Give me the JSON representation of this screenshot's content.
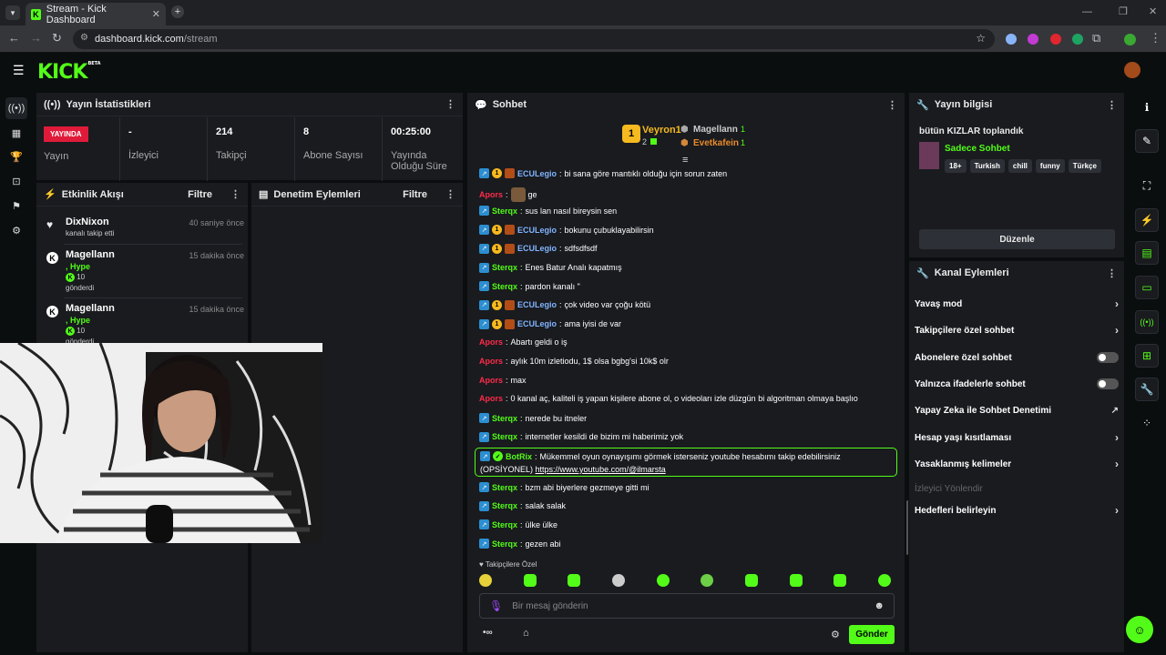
{
  "browser": {
    "tab_title": "Stream - Kick Dashboard",
    "url_host": "dashboard.kick.com",
    "url_path": "/stream"
  },
  "logo": {
    "text": "KICK",
    "beta": "BETA"
  },
  "stats_panel": {
    "title": "Yayın İstatistikleri",
    "live_badge": "YAYINDA",
    "stats": [
      {
        "value": "",
        "label": "Yayın"
      },
      {
        "value": "-",
        "label": "İzleyici"
      },
      {
        "value": "214",
        "label": "Takipçi"
      },
      {
        "value": "8",
        "label": "Abone Sayısı"
      },
      {
        "value": "00:25:00",
        "label": "Yayında Olduğu Süre"
      }
    ]
  },
  "activity_panel": {
    "title": "Etkinlik Akışı",
    "filter": "Filtre",
    "items": [
      {
        "name": "DixNixon",
        "time": "40 saniye önce",
        "detail": "kanalı takip etti"
      },
      {
        "name": "Magellann",
        "time": "15 dakika önce",
        "hype": ", Hype",
        "amount": "10",
        "detail": "gönderdi"
      },
      {
        "name": "Magellann",
        "time": "15 dakika önce",
        "hype": ", Hype",
        "amount": "10",
        "detail": "gönderdi"
      }
    ]
  },
  "moderation_panel": {
    "title": "Denetim Eylemleri",
    "filter": "Filtre"
  },
  "chat": {
    "title": "Sohbet",
    "leaderboard": {
      "first": {
        "name": "Veyron1",
        "count": "2"
      },
      "second": {
        "name": "Magellann",
        "count": "1"
      },
      "third": {
        "name": "Evetkafein",
        "count": "1"
      }
    },
    "messages": [
      {
        "user": "ECULegio",
        "color": "blue",
        "badges": "full",
        "text": "bi sana göre mantıklı olduğu için sorun zaten"
      },
      {
        "user": "Apors",
        "color": "red",
        "badges": "none",
        "text": "ge",
        "emote": true
      },
      {
        "user": "Sterqx",
        "color": "green",
        "badges": "mod",
        "text": "sus lan nasıl bireysin sen"
      },
      {
        "user": "ECULegio",
        "color": "blue",
        "badges": "full",
        "text": "bokunu çubuklayabilirsin"
      },
      {
        "user": "ECULegio",
        "color": "blue",
        "badges": "full",
        "text": "sdfsdfsdf"
      },
      {
        "user": "Sterqx",
        "color": "green",
        "badges": "mod",
        "text": "Enes Batur Analı kapatmış"
      },
      {
        "user": "Sterqx",
        "color": "green",
        "badges": "mod",
        "text": "pardon kanalı \""
      },
      {
        "user": "ECULegio",
        "color": "blue",
        "badges": "full",
        "text": "çok video var çoğu kötü"
      },
      {
        "user": "ECULegio",
        "color": "blue",
        "badges": "full",
        "text": "ama iyisi de var"
      },
      {
        "user": "Apors",
        "color": "red",
        "badges": "none",
        "text": "Abartı geldi o iş"
      },
      {
        "user": "Apors",
        "color": "red",
        "badges": "none",
        "text": "aylık 10m izletiodu, 1$ olsa bgbg'si 10k$ olr"
      },
      {
        "user": "Apors",
        "color": "red",
        "badges": "none",
        "text": "max"
      },
      {
        "user": "Apors",
        "color": "red",
        "badges": "none",
        "text": "0 kanal aç, kaliteli iş yapan kişilere abone ol, o videoları izle düzgün bi algoritman olmaya başlıo"
      },
      {
        "user": "Sterqx",
        "color": "green",
        "badges": "mod",
        "text": "nerede bu itneler"
      },
      {
        "user": "Sterqx",
        "color": "green",
        "badges": "mod",
        "text": "internetler kesildi de bizim mi haberimiz yok"
      }
    ],
    "bot_message": {
      "user": "BotRix",
      "text": "Mükemmel oyun oynayışımı görmek isterseniz youtube hesabımı takip edebilirsiniz",
      "text2": "(OPSİYONEL)",
      "link": "https://www.youtube.com/@ilmarsta"
    },
    "messages_after": [
      {
        "user": "Sterqx",
        "text": "bzm abi biyerlere gezmeye gitti mi"
      },
      {
        "user": "Sterqx",
        "text": "salak salak"
      },
      {
        "user": "Sterqx",
        "text": "ülke ülke"
      },
      {
        "user": "Sterqx",
        "text": "gezen abi"
      }
    ],
    "followers_only": "Takipçilere Özel",
    "input_placeholder": "Bir mesaj gönderin",
    "send_label": "Gönder"
  },
  "stream_info": {
    "title": "Yayın bilgisi",
    "stream_title": "bütün KIZLAR toplandık",
    "category": "Sadece Sohbet",
    "tags": [
      "18+",
      "Turkish",
      "chill",
      "funny",
      "Türkçe"
    ],
    "edit_label": "Düzenle"
  },
  "channel_actions": {
    "title": "Kanal Eylemleri",
    "items": [
      {
        "label": "Yavaş mod",
        "control": "chevron"
      },
      {
        "label": "Takipçilere özel sohbet",
        "control": "chevron"
      },
      {
        "label": "Abonelere özel sohbet",
        "control": "toggle"
      },
      {
        "label": "Yalnızca ifadelerle sohbet",
        "control": "toggle"
      },
      {
        "label": "Yapay Zeka ile Sohbet Denetimi",
        "control": "external"
      },
      {
        "label": "Hesap yaşı kısıtlaması",
        "control": "chevron"
      },
      {
        "label": "Yasaklanmış kelimeler",
        "control": "chevron"
      },
      {
        "label": "İzleyici Yönlendir",
        "control": "disabled"
      },
      {
        "label": "Hedefleri belirleyin",
        "control": "chevron"
      }
    ]
  },
  "colors": {
    "brand": "#53fc18",
    "live": "#e01b3a",
    "panel": "#191b1f"
  }
}
